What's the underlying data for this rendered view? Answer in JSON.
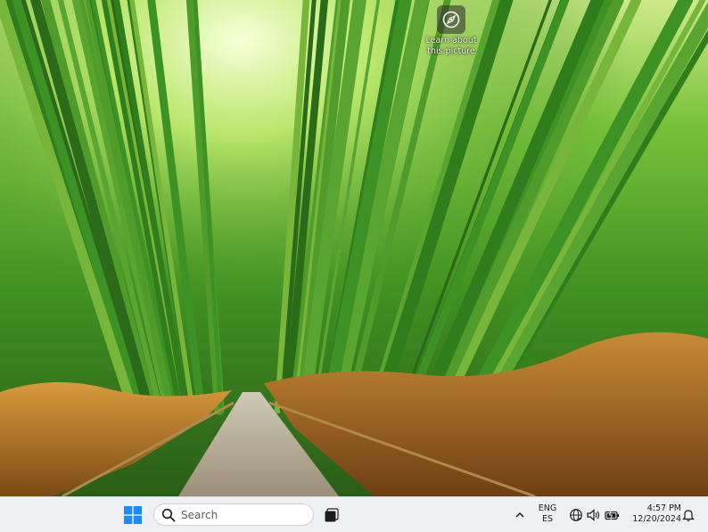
{
  "desktop": {
    "widget": {
      "text_line1": "Learn about",
      "text_line2": "this picture",
      "icon": "compass-icon"
    }
  },
  "taskbar": {
    "start_icon": "windows-logo-icon",
    "search": {
      "label": "Search",
      "icon": "search-icon"
    },
    "task_view_icon": "task-view-icon",
    "tray": {
      "chevron_icon": "chevron-up-icon",
      "lang_line1": "ENG",
      "lang_line2": "ES",
      "network_icon": "globe-network-icon",
      "volume_icon": "speaker-icon",
      "battery_icon": "battery-icon",
      "time": "4:57 PM",
      "date": "12/20/2024",
      "notification_icon": "bell-icon"
    }
  },
  "colors": {
    "taskbar_bg": "#eef0f4",
    "windows_blue": "#1a8cff"
  }
}
